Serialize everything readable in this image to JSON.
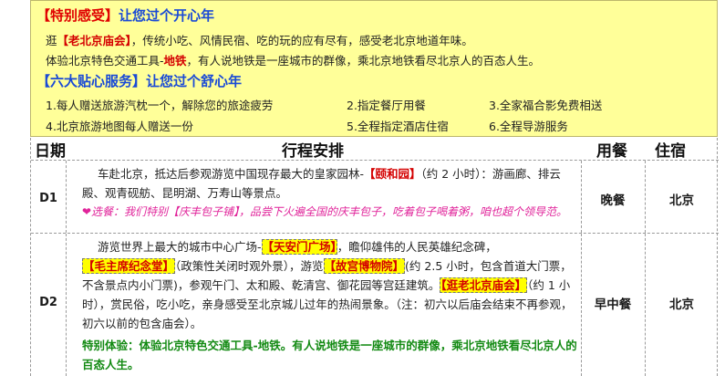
{
  "promo": {
    "heading1_bracket": "【特别感受】",
    "heading1_rest": "让您过个开心年",
    "line1_pre": "逛",
    "line1_tag": "【老北京庙会】",
    "line1_post": "，传统小吃、风情民宿、吃的玩的应有尽有，感受老北京地道年味。",
    "line2_pre": "体验北京特色交通工具-",
    "line2_tag": "地铁",
    "line2_post": "，有人说地铁是一座城市的群像，乘北京地铁看尽北京人的百态人生。",
    "heading2": "【六大贴心服务】让您过个舒心年",
    "services": [
      "1.每人赠送旅游汽枕一个，解除您的旅途疲劳",
      "2.指定餐厅用餐",
      "3.全家福合影免费相送",
      "4.北京旅游地图每人赠送一份",
      "5.全程指定酒店住宿",
      "6.全程导游服务"
    ]
  },
  "table": {
    "headers": {
      "day": "日期",
      "itinerary": "行程安排",
      "meal": "用餐",
      "stay": "住宿"
    },
    "rows": [
      {
        "day": "D1",
        "text_a": "车赴北京，抵达后参观游览中国现存最大的皇家园林-",
        "tag_a": "【颐和园】",
        "text_b": "（约 2 小时）：游画廊、排云殿、观青砚舫、昆明湖、万寿山等景点。",
        "tip": "❤选餐：我们特别【庆丰包子铺】，品尝下火遍全国的庆丰包子，吃着包子喝着粥，咱也超个领导范。",
        "meal": "晚餐",
        "stay": "北京"
      },
      {
        "day": "D2",
        "text_a": "游览世界上最大的城市中心广场-",
        "tag_a": "【天安门广场】",
        "text_b": "，瞻仰雄伟的人民英雄纪念碑，",
        "tag_b": "【毛主席纪念堂】",
        "text_c": "（政策性关闭时观外景），游览",
        "tag_c": "【故宫博物院】",
        "text_d": "(约 2.5 小时，包含首道大门票，不含景点内小门票)，参观午门、太和殿、乾清宫、御花园等宫廷建筑。",
        "tag_d": "【逛老北京庙会】",
        "text_e": "（约 1 小时），赏民俗，吃小吃，亲身感受至北京城儿过年的热闹景象。（注：初六以后庙会结束不再参观，初六以前的包含庙会）。",
        "special": "特别体验：体验北京特色交通工具-地铁。有人说地铁是一座城市的群像，乘北京地铁看尽北京人的百态人生。",
        "meal": "早中餐",
        "stay": "北京"
      }
    ]
  }
}
